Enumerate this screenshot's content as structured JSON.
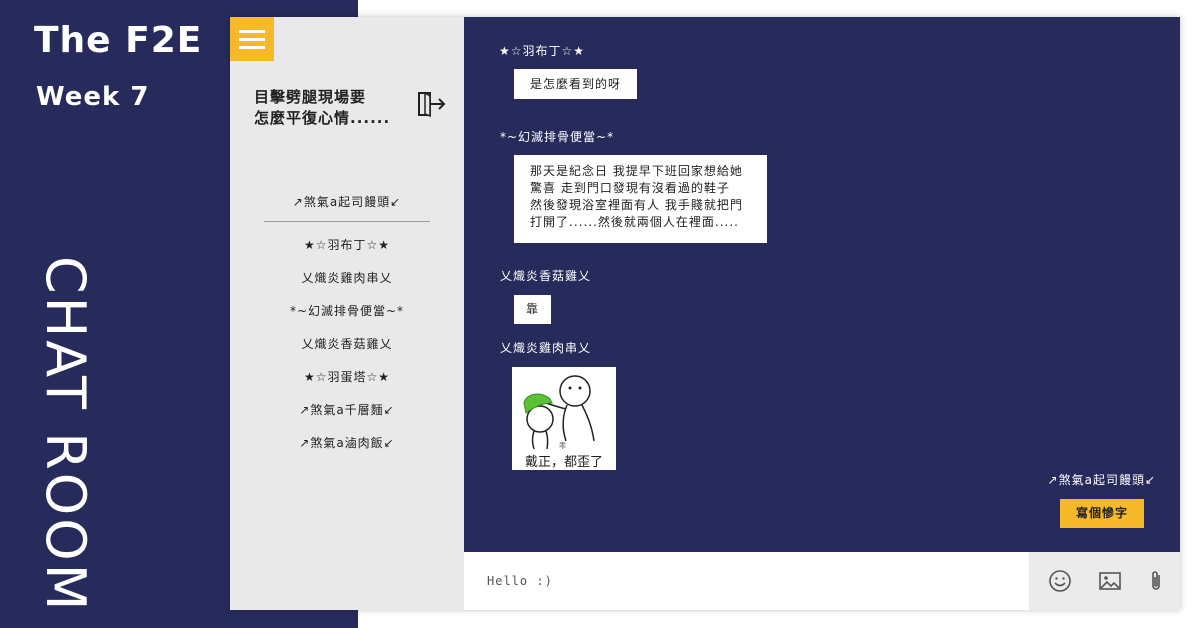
{
  "banner": {
    "title": "The F2E",
    "week": "Week 7",
    "vertical_title": "CHAT ROOM"
  },
  "sidebar": {
    "room_title_lines": [
      "目擊劈腿現場要",
      "怎麼平復心情......"
    ],
    "current_user": "↗煞氣a起司饅頭↙",
    "members": [
      "★☆羽布丁☆★",
      "乂熾炎雞肉串乂",
      "*~幻滅排骨便當~*",
      "乂熾炎香菇雞乂",
      "★☆羽蛋塔☆★",
      "↗煞氣a千層麵↙",
      "↗煞氣a滷肉飯↙"
    ]
  },
  "chat": {
    "messages": [
      {
        "sender": "★☆羽布丁☆★",
        "lines": [
          "是怎麼看到的呀"
        ]
      },
      {
        "sender": "*~幻滅排骨便當~*",
        "lines": [
          "那天是紀念日 我提早下班回家想給她",
          "驚喜 走到門口發現有沒看過的鞋子",
          "然後發現浴室裡面有人 我手賤就把門",
          "打開了......然後就兩個人在裡面....."
        ]
      },
      {
        "sender": "乂熾炎香菇雞乂",
        "lines": [
          "靠"
        ]
      },
      {
        "sender": "乂熾炎雞肉串乂",
        "sticker_caption": "戴正，都歪了",
        "sticker_small_text": "乖"
      }
    ],
    "self": {
      "name": "↗煞氣a起司饅頭↙",
      "message": "寫個慘字"
    }
  },
  "input": {
    "placeholder": "Hello :)"
  },
  "colors": {
    "navy": "#262b5c",
    "accent": "#f7b92a",
    "sidebar_bg": "#e9e9e9",
    "tool_bg": "#ebebeb"
  },
  "icons": [
    "menu-icon",
    "exit-icon",
    "emoji-icon",
    "image-icon",
    "paperclip-icon"
  ]
}
